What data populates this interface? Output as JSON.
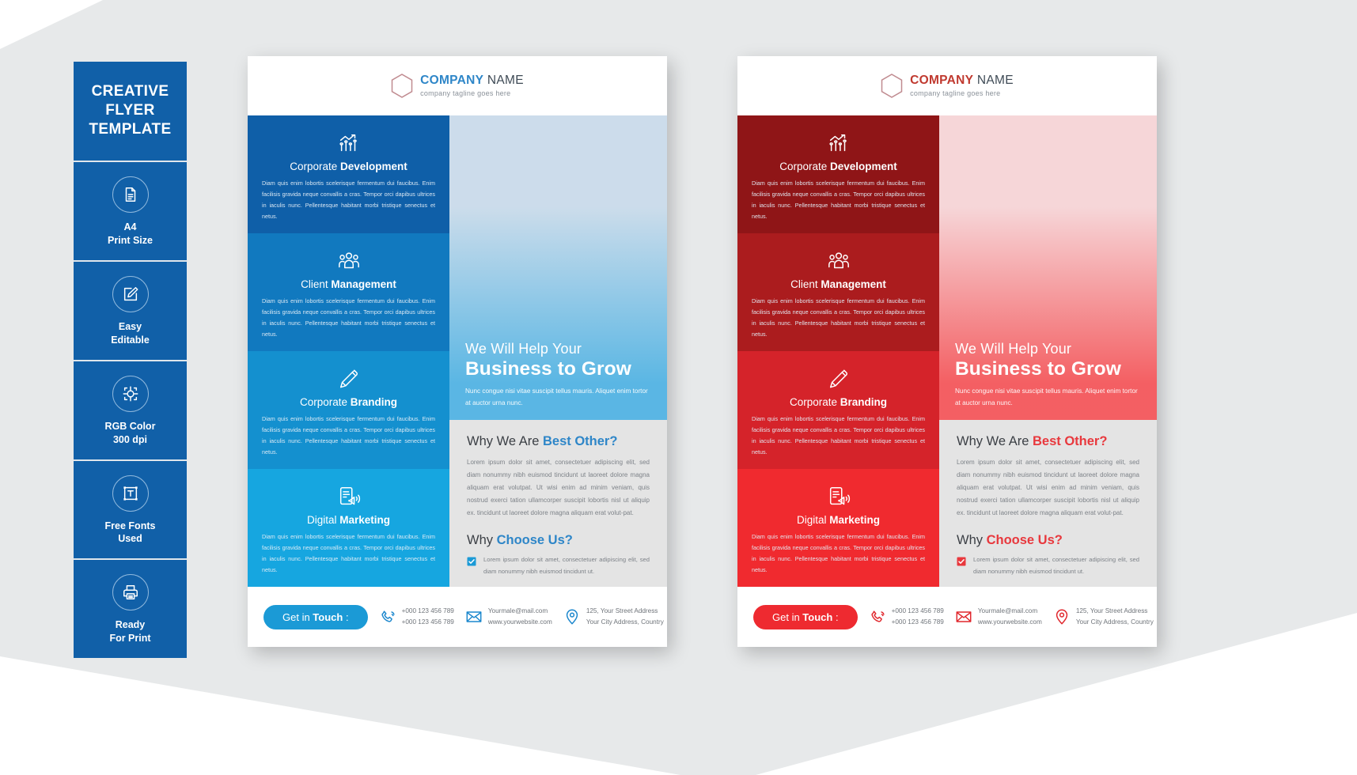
{
  "sidebar": {
    "title": "CREATIVE\nFLYER\nTEMPLATE",
    "title_lines": [
      "CREATIVE",
      "FLYER",
      "TEMPLATE"
    ],
    "accent": "#1160a8",
    "items": [
      {
        "icon": "document-icon",
        "line1": "A4",
        "line2": "Print Size"
      },
      {
        "icon": "pencil-edit-icon",
        "line1": "Easy",
        "line2": "Editable"
      },
      {
        "icon": "crosshair-move-icon",
        "line1": "RGB Color",
        "line2": "300 dpi"
      },
      {
        "icon": "text-box-icon",
        "line1": "Free Fonts",
        "line2": "Used"
      },
      {
        "icon": "printer-icon",
        "line1": "Ready",
        "line2": "For Print"
      }
    ]
  },
  "logo": {
    "name_bold": "COMPANY",
    "name_light": "NAME",
    "tagline": "company tagline goes here"
  },
  "services": [
    {
      "icon": "growth-chart-icon",
      "title_light": "Corporate",
      "title_bold": "Development",
      "text": "Diam quis enim lobortis scelerisque fermentum dui faucibus. Enim facilisis gravida neque convallis a cras. Tempor orci dapibus ultrices in iaculis nunc. Pellentesque habitant morbi tristique senectus et netus."
    },
    {
      "icon": "people-group-icon",
      "title_light": "Client",
      "title_bold": "Management",
      "text": "Diam quis enim lobortis scelerisque fermentum dui faucibus. Enim facilisis gravida neque convallis a cras. Tempor orci dapibus ultrices in iaculis nunc. Pellentesque habitant morbi tristique senectus et netus."
    },
    {
      "icon": "pencil-icon",
      "title_light": "Corporate",
      "title_bold": "Branding",
      "text": "Diam quis enim lobortis scelerisque fermentum dui faucibus. Enim facilisis gravida neque convallis a cras. Tempor orci dapibus ultrices in iaculis nunc. Pellentesque habitant morbi tristique senectus et netus."
    },
    {
      "icon": "digital-marketing-icon",
      "title_light": "Digital",
      "title_bold": "Marketing",
      "text": "Diam quis enim lobortis scelerisque fermentum dui faucibus. Enim facilisis gravida neque convallis a cras. Tempor orci dapibus ultrices in iaculis nunc. Pellentesque habitant morbi tristique senectus et netus."
    }
  ],
  "hero": {
    "line1": "We Will Help Your",
    "line2": "Business to Grow",
    "caption": "Nunc congue nisi vitae suscipit tellus mauris. Aliquet enim tortor at auctor urna nunc."
  },
  "panel": {
    "heading1_light": "Why We Are ",
    "heading1_bold": "Best Other?",
    "paragraph": "Lorem ipsum dolor sit amet, consectetuer adipiscing elit, sed diam nonummy nibh euismod tincidunt ut laoreet dolore magna aliquam erat volutpat. Ut wisi enim ad minim veniam, quis nostrud exerci tation ullamcorper suscipit lobortis nisl ut aliquip ex. tincidunt ut laoreet dolore magna aliquam erat volut-pat.",
    "heading2_light": "Why ",
    "heading2_bold": "Choose Us?",
    "checklist": [
      "Lorem ipsum dolor sit amet, consectetuer adipiscing elit, sed diam nonummy nibh euismod tincidunt ut.",
      "Lorem ipsum dolor sit amet, consectetuer adipiscing elit, sed diam nonummy nibh euismod tincidunt ut.",
      "Lorem ipsum dolor sit amet, consectetuer adipiscing elit, sed diam nonummy nibh euismod tincidunt ut."
    ]
  },
  "footer": {
    "button_light": "Get in ",
    "button_bold": "Touch",
    "button_suffix": " :",
    "phone1": "+000 123 456 789",
    "phone2": "+000 123 456 789",
    "email": "Yourmale@mail.com",
    "website": "www.yourwebsite.com",
    "address1": "125, Your Street Address",
    "address2": "Your City Address, Country"
  },
  "theme_blue": {
    "name": "blue",
    "svc1": "#0f5fa8",
    "svc2": "#1179bf",
    "svc3": "#1490cf",
    "svc4": "#16a6e0",
    "hero_top": "#b8cfe3",
    "hero_bottom": "#1a9ad9",
    "accent": "#1b87cd",
    "button": "#1b9ad6",
    "heading_accent": "#2e86c8",
    "check": "#1b9ad6"
  },
  "theme_red": {
    "name": "red",
    "svc1": "#8f1517",
    "svc2": "#ab1c1e",
    "svc3": "#d5232a",
    "svc4": "#f02a2f",
    "hero_top": "#f3c6c9",
    "hero_bottom": "#ef2126",
    "accent": "#e0262c",
    "button": "#ee2a30",
    "heading_accent": "#e8383d",
    "check": "#e8383d"
  }
}
